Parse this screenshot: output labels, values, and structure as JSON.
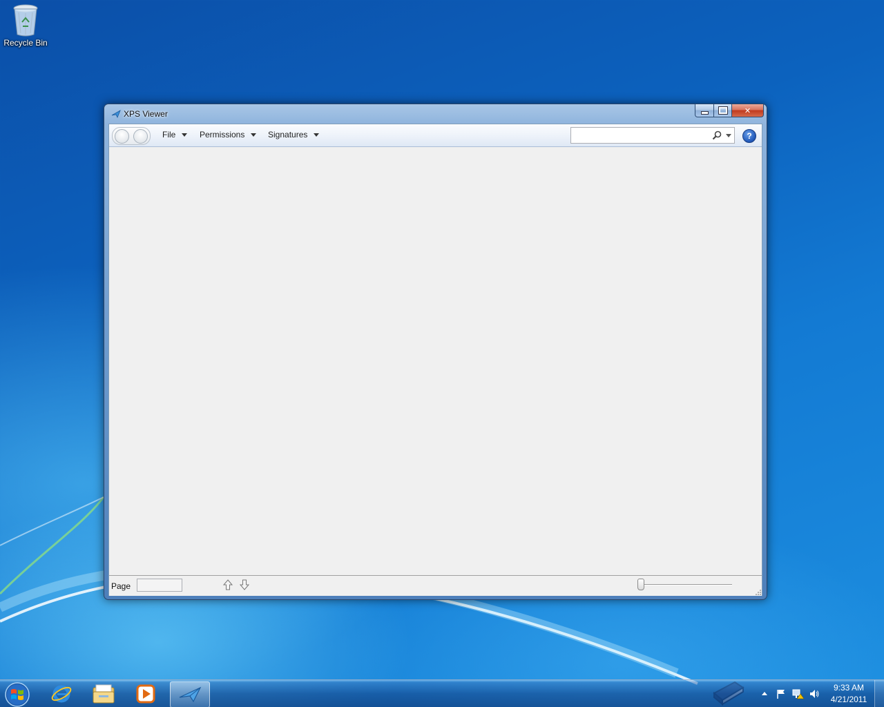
{
  "desktop": {
    "icons": [
      {
        "label": "Recycle Bin",
        "icon": "recycle-bin-icon"
      }
    ]
  },
  "window": {
    "title": "XPS Viewer",
    "icon": "xps-viewer-icon",
    "caption_buttons": [
      "minimize",
      "maximize",
      "close"
    ],
    "toolbar": {
      "menus": [
        {
          "label": "File"
        },
        {
          "label": "Permissions"
        },
        {
          "label": "Signatures"
        }
      ],
      "search": {
        "value": "",
        "placeholder": ""
      },
      "help_icon": "help-icon",
      "help_glyph": "?"
    },
    "statusbar": {
      "page_label": "Page",
      "page_value": "",
      "zoom_level": 0
    }
  },
  "taskbar": {
    "apps": [
      "internet-explorer-icon",
      "windows-explorer-icon",
      "windows-media-player-icon",
      "xps-viewer-icon"
    ],
    "active_app": "xps-viewer-icon",
    "clock": {
      "time": "9:33 AM",
      "date": "4/21/2011"
    }
  },
  "colors": {
    "accent": "#1e56b8",
    "window_frame": "#6c9acd",
    "client_bg": "#f0f0f0",
    "close_button": "#c13a1e"
  }
}
